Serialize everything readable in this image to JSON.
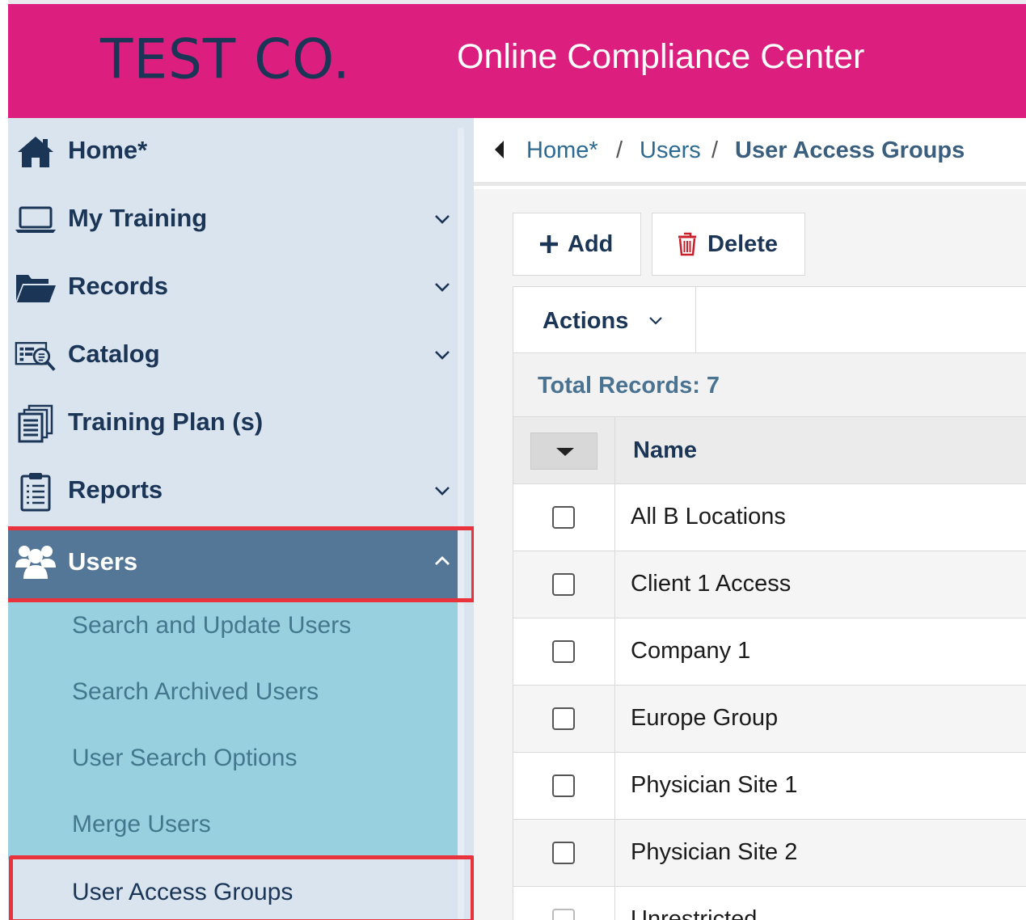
{
  "header": {
    "logo_text": "TEST CO.",
    "title": "Online Compliance Center",
    "bg_color": "#dc1f7e"
  },
  "sidebar": {
    "items": [
      {
        "label": "Home*",
        "icon": "home-icon",
        "has_chevron": false
      },
      {
        "label": "My Training",
        "icon": "laptop-icon",
        "has_chevron": true
      },
      {
        "label": "Records",
        "icon": "folder-open-icon",
        "has_chevron": true
      },
      {
        "label": "Catalog",
        "icon": "catalog-search-icon",
        "has_chevron": true
      },
      {
        "label": "Training Plan (s)",
        "icon": "document-stack-icon",
        "has_chevron": false
      },
      {
        "label": "Reports",
        "icon": "clipboard-icon",
        "has_chevron": true
      },
      {
        "label": "Users",
        "icon": "users-icon",
        "has_chevron": true,
        "expanded": true
      }
    ],
    "users_submenu": [
      {
        "label": "Search and Update Users"
      },
      {
        "label": "Search Archived Users"
      },
      {
        "label": "User Search Options"
      },
      {
        "label": "Merge Users"
      },
      {
        "label": "User Access Groups",
        "active": true
      }
    ],
    "highlight_color": "#e8333c"
  },
  "breadcrumb": {
    "items": [
      "Home*",
      "Users",
      "User Access Groups"
    ],
    "separator": "/"
  },
  "toolbar": {
    "add_label": "Add",
    "delete_label": "Delete",
    "actions_label": "Actions"
  },
  "records": {
    "total_label": "Total Records: 7"
  },
  "table": {
    "column_name": "Name",
    "rows": [
      {
        "name": "All B Locations",
        "checked": false
      },
      {
        "name": "Client 1 Access",
        "checked": false
      },
      {
        "name": "Company 1",
        "checked": false
      },
      {
        "name": "Europe Group",
        "checked": false
      },
      {
        "name": "Physician Site 1",
        "checked": false
      },
      {
        "name": "Physician Site 2",
        "checked": false
      },
      {
        "name": "Unrestricted",
        "checked": false
      }
    ]
  }
}
